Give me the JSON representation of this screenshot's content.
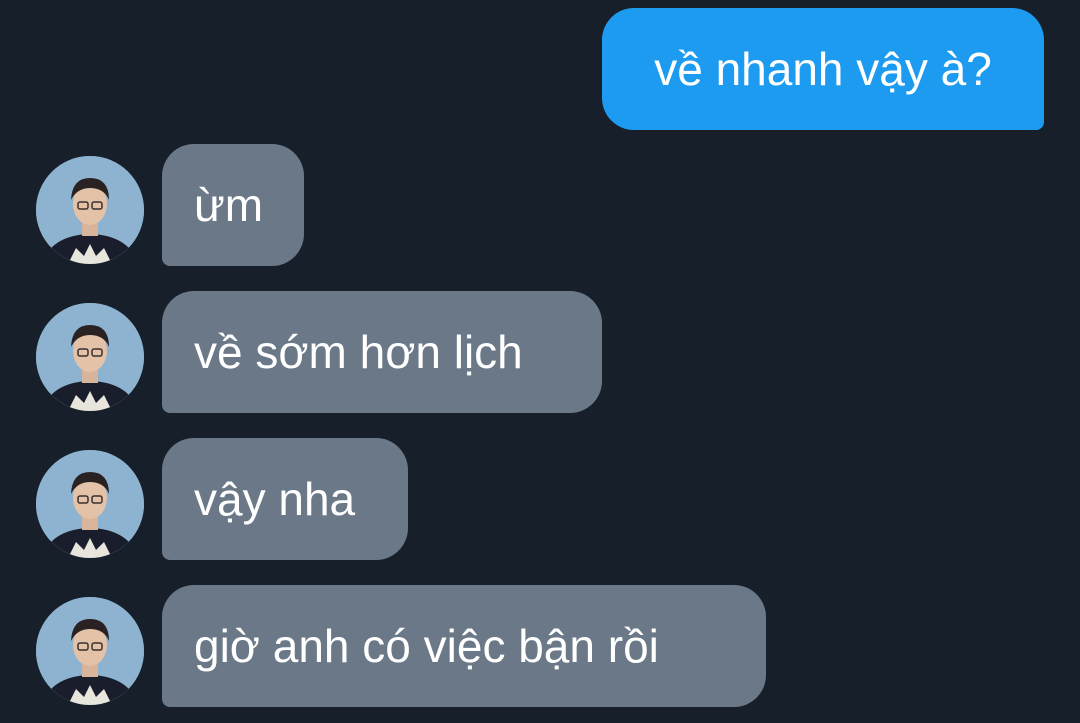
{
  "conversation": {
    "outgoing": [
      {
        "text": "về nhanh vậy à?"
      }
    ],
    "incoming": [
      {
        "text": "ừm"
      },
      {
        "text": "về sớm hơn lịch"
      },
      {
        "text": "vậy nha"
      },
      {
        "text": "giờ anh có việc bận rồi"
      }
    ]
  },
  "colors": {
    "background": "#17202a",
    "outgoing_bubble": "#1d9bf0",
    "incoming_bubble": "#6a7887",
    "text": "#ffffff"
  },
  "icons": {
    "avatar": "contact-avatar-photo"
  }
}
